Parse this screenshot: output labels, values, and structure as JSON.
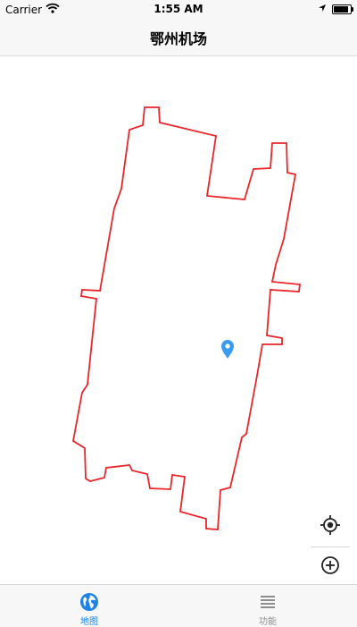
{
  "status_bar": {
    "carrier": "Carrier",
    "time": "1:55 AM",
    "icons": [
      "wifi-icon",
      "location-arrow-icon",
      "battery-icon"
    ],
    "battery_level": 0.9
  },
  "nav": {
    "title": "鄂州机场"
  },
  "map": {
    "boundary_color": "#e8262b",
    "marker_color": "#3a9bf0",
    "marker_icon": "location-pin-icon"
  },
  "controls": {
    "icons": [
      "locate-icon",
      "zoom-in-icon",
      "zoom-out-icon"
    ]
  },
  "tabs": [
    {
      "label": "地图",
      "icon": "globe-icon",
      "active": true,
      "color": "#1f83e6"
    },
    {
      "label": "功能",
      "icon": "list-icon",
      "active": false,
      "color": "#8e8e8e"
    }
  ]
}
